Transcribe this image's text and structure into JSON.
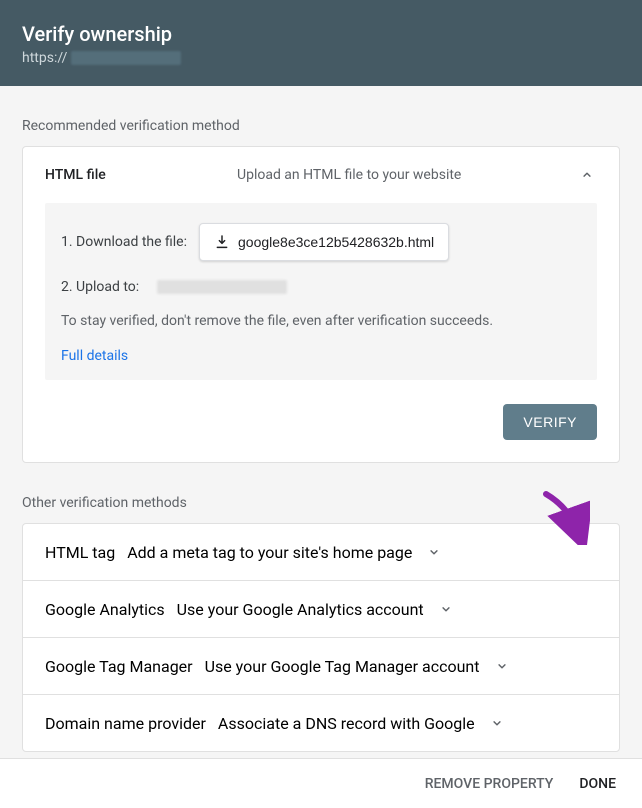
{
  "header": {
    "title": "Verify ownership",
    "url_prefix": "https://"
  },
  "recommended": {
    "section_label": "Recommended verification method",
    "method_title": "HTML file",
    "method_desc": "Upload an HTML file to your website",
    "step1_label": "1. Download the file:",
    "download_filename": "google8e3ce12b5428632b.html",
    "step2_label": "2. Upload to:",
    "note": "To stay verified, don't remove the file, even after verification succeeds.",
    "details_link": "Full details",
    "verify_button": "VERIFY"
  },
  "other": {
    "section_label": "Other verification methods",
    "methods": [
      {
        "title": "HTML tag",
        "desc": "Add a meta tag to your site's home page"
      },
      {
        "title": "Google Analytics",
        "desc": "Use your Google Analytics account"
      },
      {
        "title": "Google Tag Manager",
        "desc": "Use your Google Tag Manager account"
      },
      {
        "title": "Domain name provider",
        "desc": "Associate a DNS record with Google"
      }
    ]
  },
  "footer": {
    "remove": "REMOVE PROPERTY",
    "done": "DONE"
  },
  "colors": {
    "header_bg": "#455a64",
    "accent_link": "#1a73e8",
    "verify_bg": "#607d8b",
    "arrow": "#8e24aa"
  }
}
